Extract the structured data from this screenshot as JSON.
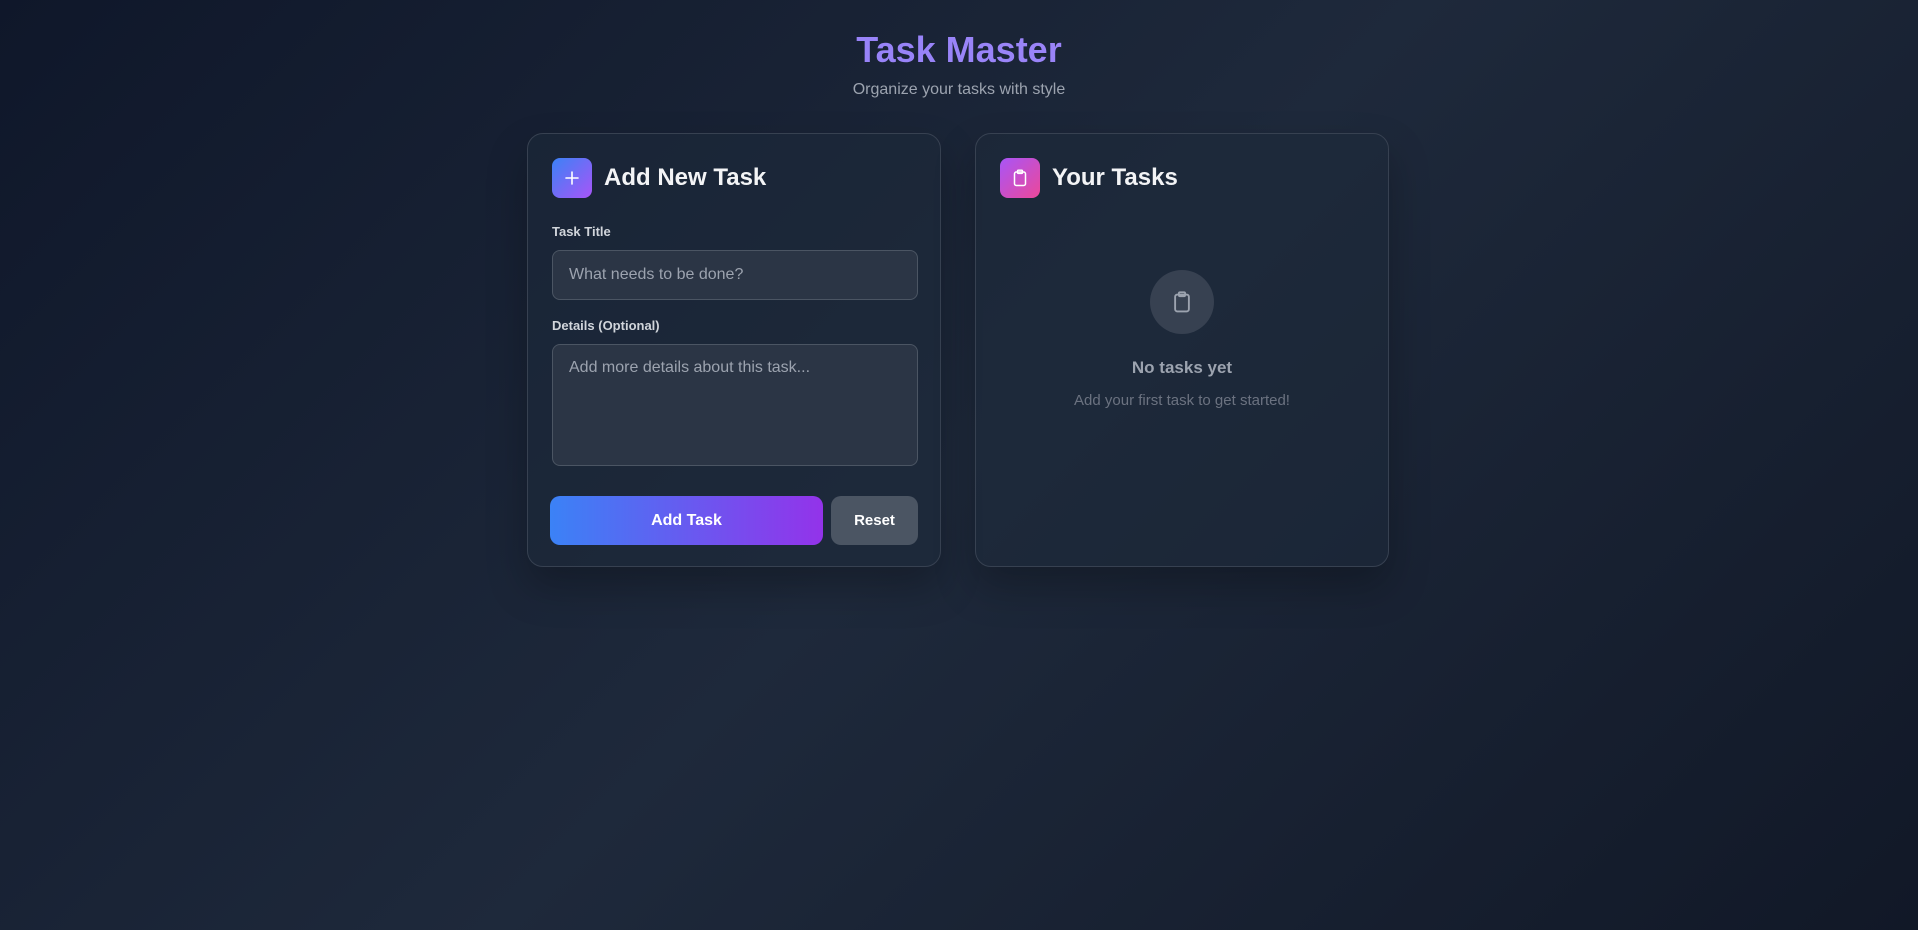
{
  "header": {
    "title": "Task Master",
    "subtitle": "Organize your tasks with style"
  },
  "add_card": {
    "icon": "plus-icon",
    "title": "Add New Task",
    "title_label": "Task Title",
    "title_placeholder": "What needs to be done?",
    "title_value": "",
    "details_label": "Details (Optional)",
    "details_placeholder": "Add more details about this task...",
    "details_value": "",
    "add_button": "Add Task",
    "reset_button": "Reset"
  },
  "tasks_card": {
    "icon": "clipboard-icon",
    "title": "Your Tasks",
    "empty_icon": "clipboard-icon",
    "empty_title": "No tasks yet",
    "empty_subtitle": "Add your first task to get started!"
  },
  "colors": {
    "accent_gradient_start": "#3b82f6",
    "accent_gradient_end": "#9333ea",
    "title_color": "#8b7cf6",
    "background": "#0f172a"
  }
}
